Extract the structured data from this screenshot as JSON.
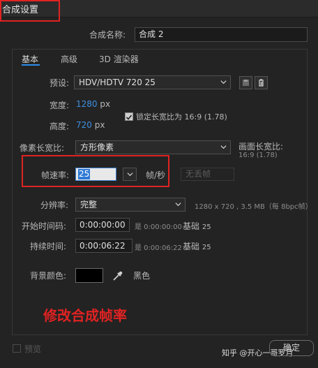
{
  "title": "合成设置",
  "comp_name": {
    "label": "合成名称:",
    "value": "合成 2"
  },
  "tabs": [
    {
      "label": "基本",
      "active": true
    },
    {
      "label": "高级",
      "active": false
    },
    {
      "label": "3D 渲染器",
      "active": false
    }
  ],
  "preset": {
    "label": "预设:",
    "value": "HDV/HDTV 720 25"
  },
  "width": {
    "label": "宽度:",
    "value": "1280",
    "unit": "px"
  },
  "height": {
    "label": "高度:",
    "value": "720",
    "unit": "px"
  },
  "lock_aspect": {
    "label": "锁定长宽比为 16:9 (1.78)",
    "checked": true
  },
  "pixel_aspect": {
    "label": "像素长宽比:",
    "value": "方形像素"
  },
  "frame_aspect": {
    "label": "画面长宽比:",
    "value": "16:9 (1.78)"
  },
  "frame_rate": {
    "label": "帧速率:",
    "value": "25",
    "unit": "帧/秒",
    "drop_frame": "无丢帧"
  },
  "resolution": {
    "label": "分辨率:",
    "value": "完整",
    "info": "1280 x 720 , 3.5 MB（每 8bpc帧）"
  },
  "start_timecode": {
    "label": "开始时间码:",
    "value": "0:00:00:00",
    "info": "是 0:00:00:00",
    "base_label": "基础",
    "base_value": "25"
  },
  "duration": {
    "label": "持续时间:",
    "value": "0:00:06:22",
    "info": "是 0:00:06:22",
    "base_label": "基础",
    "base_value": "25"
  },
  "background": {
    "label": "背景颜色:",
    "color_name": "黑色",
    "color": "#000000"
  },
  "annotation": "修改合成帧率",
  "preview": {
    "label": "预览",
    "checked": false
  },
  "ok_button": "确定",
  "watermark": "知乎 @开心一哥罗月",
  "colors": {
    "accent": "#2d8ceb",
    "highlight": "#e02222",
    "link": "#3e8fe0"
  }
}
